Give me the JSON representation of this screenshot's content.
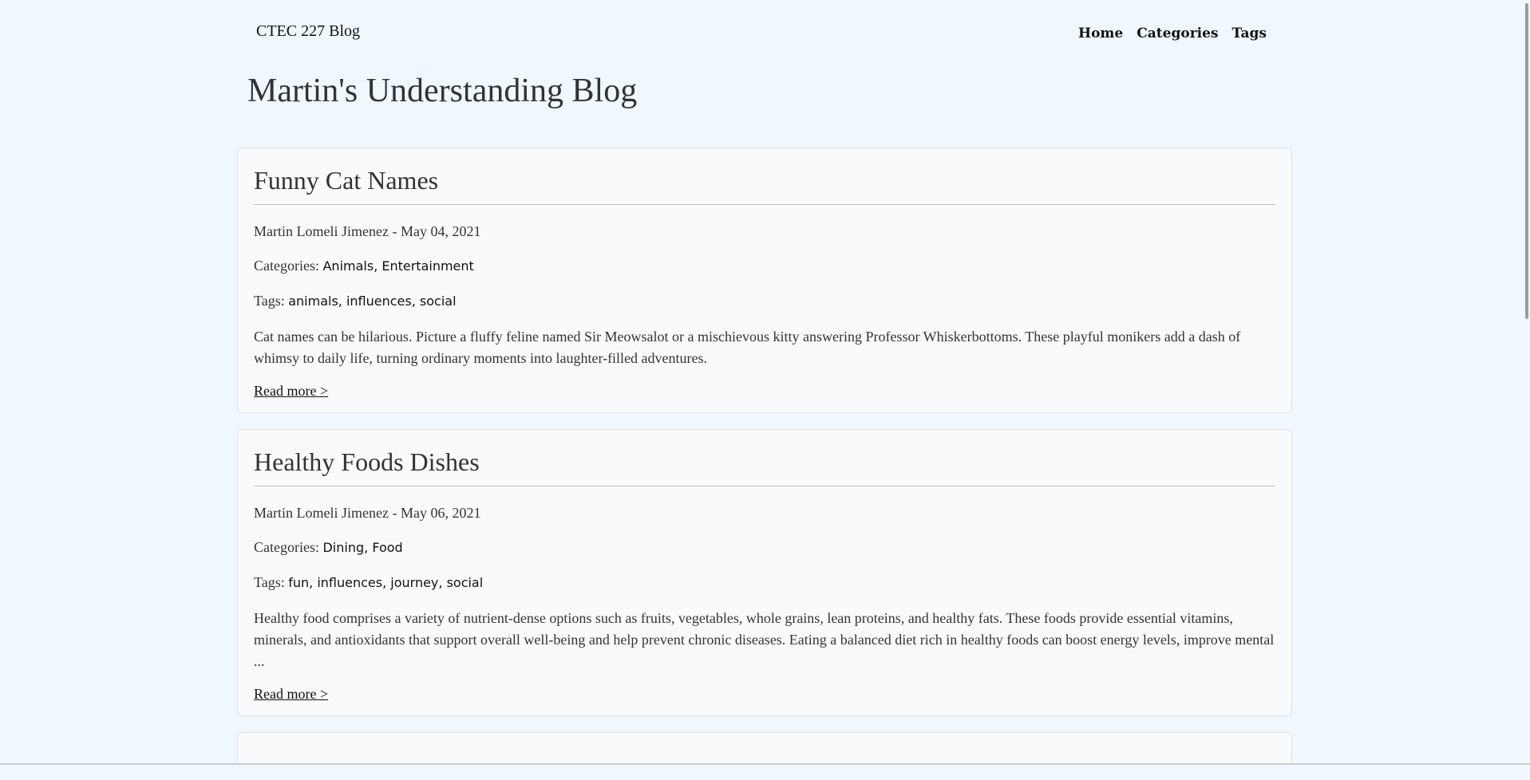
{
  "header": {
    "brand": "CTEC 227 Blog",
    "nav": [
      "Home",
      "Categories",
      "Tags"
    ]
  },
  "site_title": "Martin's Understanding Blog",
  "posts": [
    {
      "title": "Funny Cat Names",
      "author": "Martin Lomeli Jimenez",
      "date": "May 04, 2021",
      "categories_label": "Categories:",
      "categories": [
        "Animals",
        "Entertainment"
      ],
      "tags_label": "Tags:",
      "tags": [
        "animals",
        "influences",
        "social"
      ],
      "excerpt": "Cat names can be hilarious. Picture a fluffy feline named Sir Meowsalot or a mischievous kitty answering Professor Whiskerbottoms. These playful monikers add a dash of whimsy to daily life, turning ordinary moments into laughter-filled adventures.",
      "read_more": "Read more >"
    },
    {
      "title": "Healthy Foods Dishes",
      "author": "Martin Lomeli Jimenez",
      "date": "May 06, 2021",
      "categories_label": "Categories:",
      "categories": [
        "Dining",
        "Food"
      ],
      "tags_label": "Tags:",
      "tags": [
        "fun",
        "influences",
        "journey",
        "social"
      ],
      "excerpt": "Healthy food comprises a variety of nutrient-dense options such as fruits, vegetables, whole grains, lean proteins, and healthy fats. These foods provide essential vitamins, minerals, and antioxidants that support overall well-being and help prevent chronic diseases. Eating a balanced diet rich in healthy foods can boost energy levels, improve mental ...",
      "read_more": "Read more >"
    }
  ]
}
